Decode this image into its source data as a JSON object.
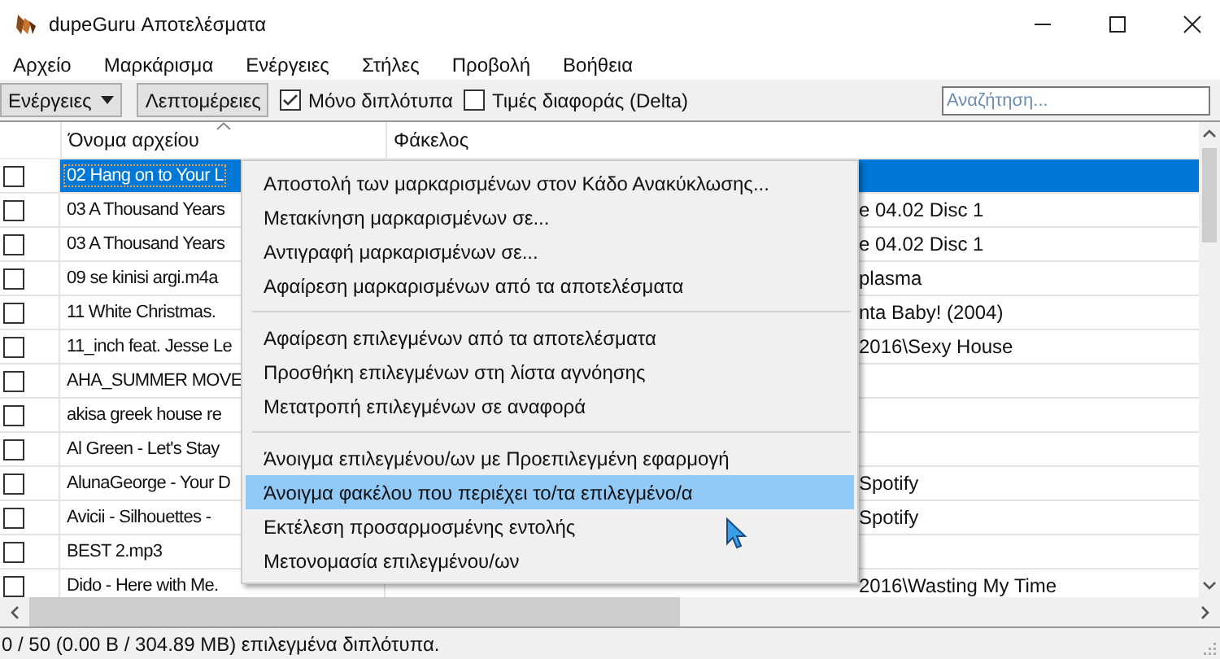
{
  "window": {
    "title": "dupeGuru Αποτελέσματα"
  },
  "menubar": [
    "Αρχείο",
    "Μαρκάρισμα",
    "Ενέργειες",
    "Στήλες",
    "Προβολή",
    "Βοήθεια"
  ],
  "toolbar": {
    "actions_button": "Ενέργειες",
    "details_button": "Λεπτομέρειες",
    "checkboxes": [
      {
        "label": "Μόνο διπλότυπα",
        "checked": true
      },
      {
        "label": "Τιμές διαφοράς (Delta)",
        "checked": false
      }
    ],
    "search": {
      "placeholder": "Αναζήτηση..."
    }
  },
  "table": {
    "columns": [
      "Όνομα αρχείου",
      "Φάκελος"
    ],
    "rows": [
      {
        "checked": false,
        "selected": true,
        "name": "02 Hang on to Your L"
      },
      {
        "checked": false,
        "selected": false,
        "name": "03 A Thousand Years",
        "folder": "e 04.02 Disc 1"
      },
      {
        "checked": false,
        "selected": false,
        "name": "03 A Thousand Years",
        "folder": "e 04.02 Disc 1"
      },
      {
        "checked": false,
        "selected": false,
        "name": "09 se kinisi argi.m4a",
        "folder": "plasma"
      },
      {
        "checked": false,
        "selected": false,
        "name": "11 White Christmas.",
        "folder": "nta Baby! (2004)"
      },
      {
        "checked": false,
        "selected": false,
        "name": "11_inch feat. Jesse Le",
        "folder": "2016\\Sexy House"
      },
      {
        "checked": false,
        "selected": false,
        "name": "AHA_SUMMER MOVE"
      },
      {
        "checked": false,
        "selected": false,
        "name": "akisa greek house re"
      },
      {
        "checked": false,
        "selected": false,
        "name": "Al Green - Let's Stay"
      },
      {
        "checked": false,
        "selected": false,
        "name": "AlunaGeorge - Your D",
        "folder": "Spotify"
      },
      {
        "checked": false,
        "selected": false,
        "name": "Avicii - Silhouettes -",
        "folder": "Spotify"
      },
      {
        "checked": false,
        "selected": false,
        "name": "BEST 2.mp3"
      },
      {
        "checked": false,
        "selected": false,
        "name": "Dido - Here with Me.",
        "folder": "2016\\Wasting My Time"
      }
    ]
  },
  "context_menu": {
    "groups": [
      [
        {
          "label": "Αποστολή των μαρκαρισμένων στον Κάδο Ανακύκλωσης...",
          "selected": false
        },
        {
          "label": "Μετακίνηση μαρκαρισμένων σε...",
          "selected": false
        },
        {
          "label": "Αντιγραφή μαρκαρισμένων σε...",
          "selected": false
        },
        {
          "label": "Αφαίρεση μαρκαρισμένων από τα αποτελέσματα",
          "selected": false
        }
      ],
      [
        {
          "label": "Αφαίρεση επιλεγμένων από τα αποτελέσματα",
          "selected": false
        },
        {
          "label": "Προσθήκη επιλεγμένων στη λίστα αγνόησης",
          "selected": false
        },
        {
          "label": "Μετατροπή επιλεγμένων σε αναφορά",
          "selected": false
        }
      ],
      [
        {
          "label": "Άνοιγμα επιλεγμένου/ων με Προεπιλεγμένη εφαρμογή",
          "selected": false
        },
        {
          "label": "Άνοιγμα φακέλου που περιέχει το/τα επιλεγμένο/α",
          "selected": true
        },
        {
          "label": "Εκτέλεση προσαρμοσμένης εντολής",
          "selected": false
        },
        {
          "label": "Μετονομασία επιλεγμένου/ων",
          "selected": false
        }
      ]
    ]
  },
  "status_bar": "0 / 50 (0.00 B / 304.89 MB) επιλεγμένα διπλότυπα."
}
